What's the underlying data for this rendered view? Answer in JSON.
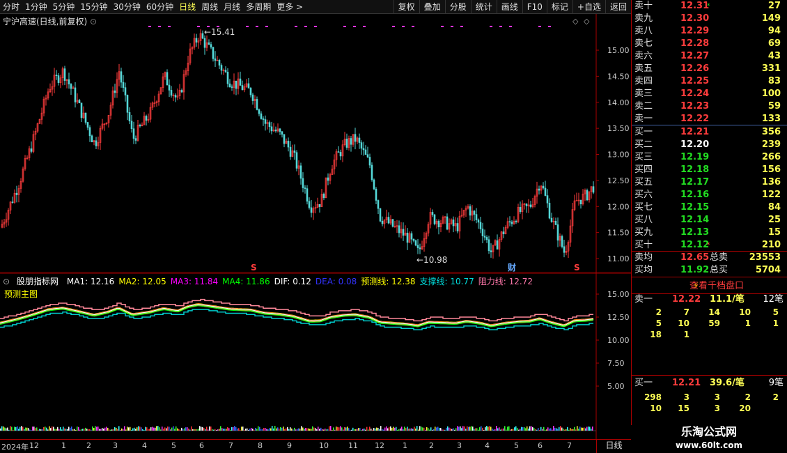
{
  "toolbar": {
    "periods": [
      "分时",
      "1分钟",
      "5分钟",
      "15分钟",
      "30分钟",
      "60分钟",
      "日线",
      "周线",
      "月线",
      "多周期",
      "更多 >"
    ],
    "active_period": "日线",
    "actions": [
      "复权",
      "叠加",
      "分股",
      "统计",
      "画线",
      "F10",
      "标记",
      "+自选",
      "返回"
    ]
  },
  "chart": {
    "title": "宁沪高速(日线,前复权)",
    "high_label": "15.41",
    "low_label": "10.98",
    "price_ticks": [
      "15.00",
      "14.50",
      "14.00",
      "13.50",
      "13.00",
      "12.50",
      "12.00",
      "11.50",
      "11.00"
    ],
    "markers": [
      "S",
      "财",
      "S"
    ]
  },
  "indicator": {
    "name": "股朋指标网",
    "legend": [
      {
        "label": "MA1: 12.16",
        "color": "#ffffff"
      },
      {
        "label": "MA2: 12.05",
        "color": "#ffff00"
      },
      {
        "label": "MA3: 11.84",
        "color": "#ff00ff"
      },
      {
        "label": "MA4: 11.86",
        "color": "#00ff00"
      },
      {
        "label": "DIF: 0.12",
        "color": "#ffffff"
      },
      {
        "label": "DEA: 0.08",
        "color": "#3333ff"
      },
      {
        "label": "预测线: 12.38",
        "color": "#ffff00"
      },
      {
        "label": "支撑线: 10.77",
        "color": "#00dddd"
      },
      {
        "label": "阻力线: 12.72",
        "color": "#ff77aa"
      }
    ],
    "sub_label": "预测主图",
    "ticks": [
      "15.00",
      "12.50",
      "10.00",
      "7.50",
      "5.00"
    ]
  },
  "time_axis": {
    "labels": [
      "2024年",
      "12",
      "1",
      "2",
      "3",
      "4",
      "5",
      "6",
      "7",
      "8",
      "9",
      "10",
      "11",
      "12",
      "1",
      "2",
      "3",
      "4",
      "5",
      "6",
      "7"
    ],
    "period": "日线"
  },
  "quote": {
    "sells": [
      {
        "label": "卖十",
        "price": "12.31",
        "vol": "27",
        "mark": "*"
      },
      {
        "label": "卖九",
        "price": "12.30",
        "vol": "149"
      },
      {
        "label": "卖八",
        "price": "12.29",
        "vol": "94"
      },
      {
        "label": "卖七",
        "price": "12.28",
        "vol": "69"
      },
      {
        "label": "卖六",
        "price": "12.27",
        "vol": "43"
      },
      {
        "label": "卖五",
        "price": "12.26",
        "vol": "331"
      },
      {
        "label": "卖四",
        "price": "12.25",
        "vol": "83"
      },
      {
        "label": "卖三",
        "price": "12.24",
        "vol": "100"
      },
      {
        "label": "卖二",
        "price": "12.23",
        "vol": "59"
      },
      {
        "label": "卖一",
        "price": "12.22",
        "vol": "133"
      }
    ],
    "buys": [
      {
        "label": "买一",
        "price": "12.21",
        "vol": "356"
      },
      {
        "label": "买二",
        "price": "12.20",
        "vol": "239"
      },
      {
        "label": "买三",
        "price": "12.19",
        "vol": "266"
      },
      {
        "label": "买四",
        "price": "12.18",
        "vol": "156"
      },
      {
        "label": "买五",
        "price": "12.17",
        "vol": "136"
      },
      {
        "label": "买六",
        "price": "12.16",
        "vol": "122"
      },
      {
        "label": "买七",
        "price": "12.15",
        "vol": "84"
      },
      {
        "label": "买八",
        "price": "12.14",
        "vol": "25"
      },
      {
        "label": "买九",
        "price": "12.13",
        "vol": "15"
      },
      {
        "label": "买十",
        "price": "12.12",
        "vol": "210",
        "mark": "*"
      }
    ],
    "avg_sell_label": "卖均",
    "avg_sell": "12.65",
    "total_sell_label": "总卖",
    "total_sell": "23553",
    "avg_buy_label": "买均",
    "avg_buy": "11.92",
    "total_buy_label": "总买",
    "total_buy": "5704",
    "thousand_label": "查看千档盘口",
    "sell1_label": "卖一",
    "sell1_price": "12.22",
    "sell1_per": "11.1/笔",
    "sell1_count": "12笔",
    "sell_queue": [
      [
        "2",
        "7",
        "14",
        "10",
        "5"
      ],
      [
        "5",
        "10",
        "59",
        "1",
        "1"
      ],
      [
        "18",
        "1"
      ]
    ],
    "buy1_label": "买一",
    "buy1_price": "12.21",
    "buy1_per": "39.6/笔",
    "buy1_count": "9笔",
    "buy_queue": [
      [
        "298",
        "3",
        "3",
        "2",
        "2"
      ],
      [
        "10",
        "15",
        "3",
        "20"
      ]
    ]
  },
  "watermark": {
    "line1": "乐淘公式网",
    "line2": "www.60lt.com"
  }
}
